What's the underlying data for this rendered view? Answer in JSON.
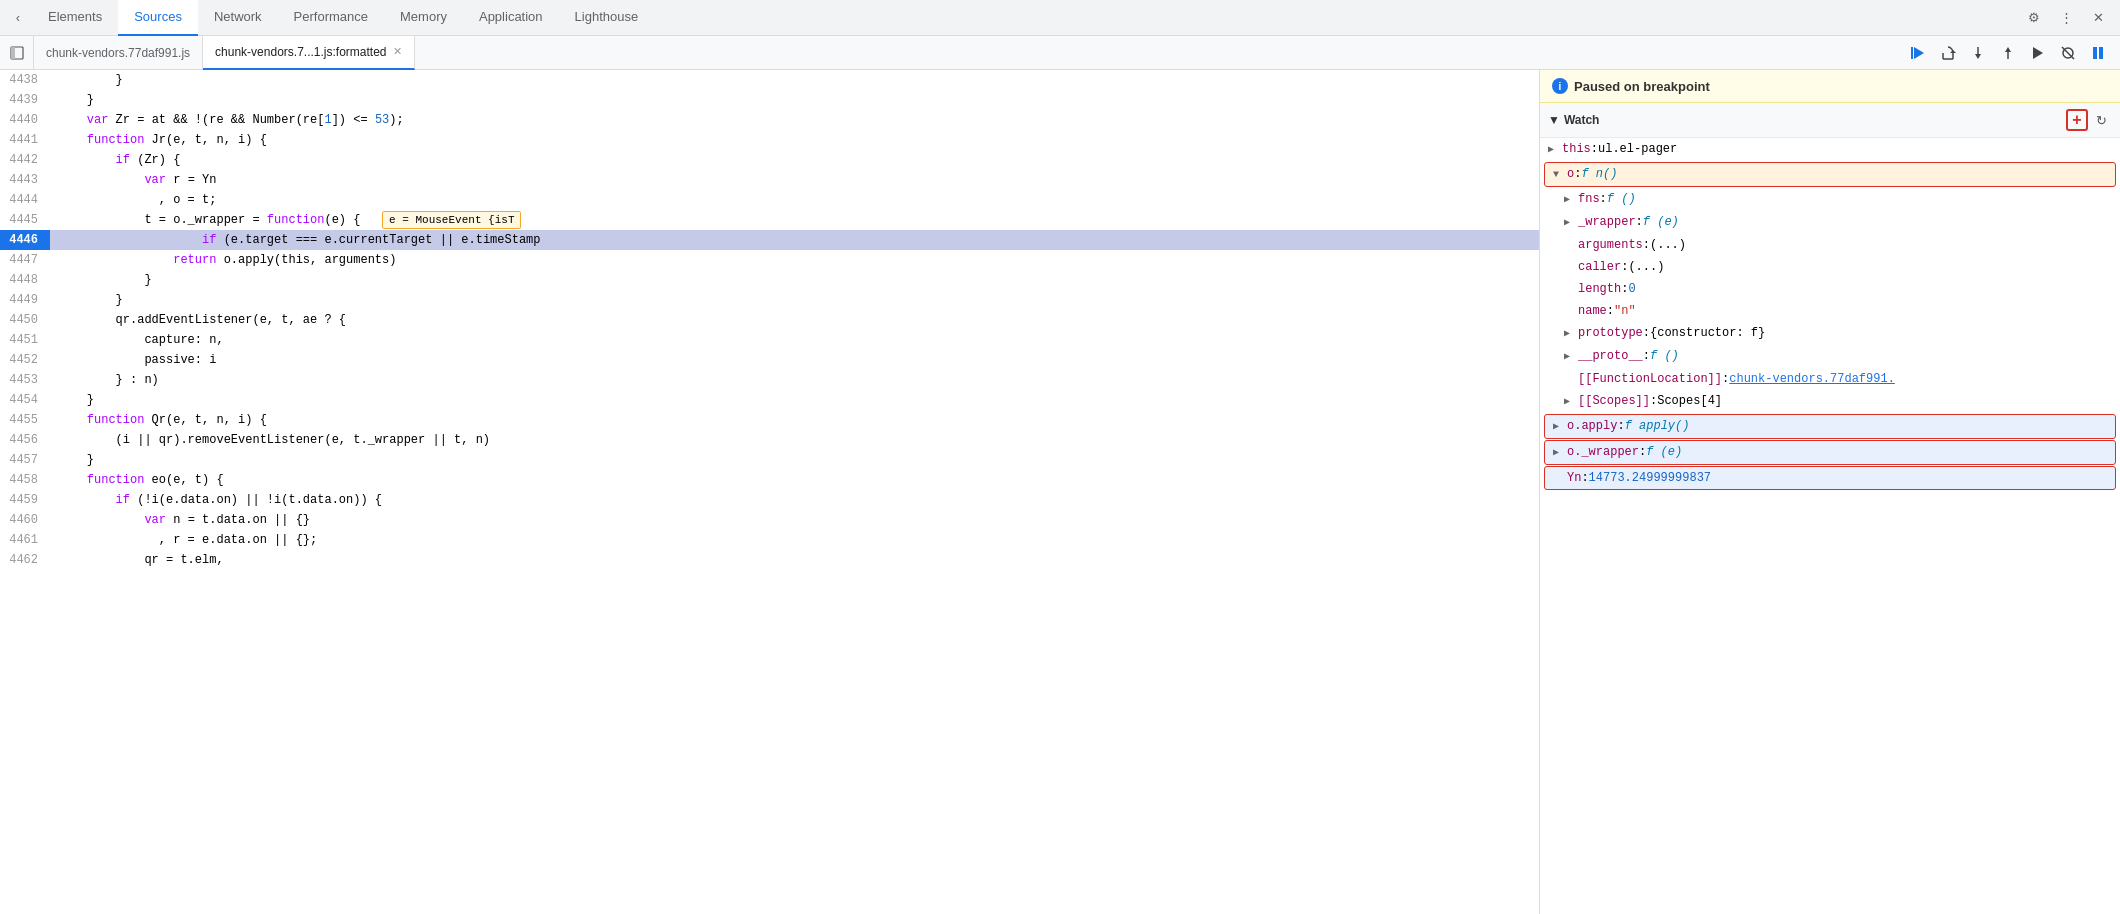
{
  "tabs": {
    "items": [
      {
        "label": "Elements",
        "active": false
      },
      {
        "label": "Sources",
        "active": true
      },
      {
        "label": "Network",
        "active": false
      },
      {
        "label": "Performance",
        "active": false
      },
      {
        "label": "Memory",
        "active": false
      },
      {
        "label": "Application",
        "active": false
      },
      {
        "label": "Lighthouse",
        "active": false
      }
    ]
  },
  "file_tabs": {
    "tab1": {
      "label": "chunk-vendors.77daf991.js",
      "active": false
    },
    "tab2": {
      "label": "chunk-vendors.7...1.js:formatted",
      "active": true
    }
  },
  "breakpoint_notice": {
    "text": "Paused on breakpoint"
  },
  "watch": {
    "title": "Watch",
    "add_label": "+",
    "items": [
      {
        "indent": 0,
        "arrow": "▶",
        "name": "this",
        "colon": ":",
        "value": "ul.el-pager",
        "type": "plain"
      },
      {
        "indent": 0,
        "arrow": "▼",
        "name": "o",
        "colon": ":",
        "value": "f n()",
        "type": "fn",
        "highlighted": true
      },
      {
        "indent": 1,
        "arrow": "▶",
        "name": "fns",
        "colon": ":",
        "value": "f ()",
        "type": "fn"
      },
      {
        "indent": 1,
        "arrow": "▶",
        "name": "_wrapper",
        "colon": ":",
        "value": "f (e)",
        "type": "fn"
      },
      {
        "indent": 1,
        "arrow": "",
        "name": "arguments",
        "colon": ":",
        "value": "(...)",
        "type": "plain"
      },
      {
        "indent": 1,
        "arrow": "",
        "name": "caller",
        "colon": ":",
        "value": "(...)",
        "type": "plain"
      },
      {
        "indent": 1,
        "arrow": "",
        "name": "length",
        "colon": ":",
        "value": "0",
        "type": "num"
      },
      {
        "indent": 1,
        "arrow": "",
        "name": "name",
        "colon": ":",
        "value": "\"n\"",
        "type": "str"
      },
      {
        "indent": 1,
        "arrow": "▶",
        "name": "prototype",
        "colon": ":",
        "value": "{constructor: f}",
        "type": "plain"
      },
      {
        "indent": 1,
        "arrow": "▶",
        "name": "__proto__",
        "colon": ":",
        "value": "f ()",
        "type": "fn"
      },
      {
        "indent": 1,
        "arrow": "",
        "name": "[[FunctionLocation]]",
        "colon": ":",
        "value": "chunk-vendors.77daf991.",
        "type": "link"
      },
      {
        "indent": 1,
        "arrow": "▶",
        "name": "[[Scopes]]",
        "colon": ":",
        "value": "Scopes[4]",
        "type": "plain"
      },
      {
        "indent": 0,
        "arrow": "▶",
        "name": "o.apply",
        "colon": ":",
        "value": "f apply()",
        "type": "fn",
        "highlighted_blue": true
      },
      {
        "indent": 0,
        "arrow": "▶",
        "name": "o._wrapper",
        "colon": ":",
        "value": "f (e)",
        "type": "fn",
        "highlighted_blue": true
      },
      {
        "indent": 0,
        "arrow": "",
        "name": "Yn",
        "colon": ":",
        "value": "14773.24999999837",
        "type": "num",
        "highlighted_blue": true
      }
    ]
  },
  "code_lines": [
    {
      "num": 4438,
      "content": "        }",
      "active": false
    },
    {
      "num": 4439,
      "content": "    }",
      "active": false
    },
    {
      "num": 4440,
      "content": "    var Zr = at && !(re && Number(re[1]) <= 53);",
      "active": false
    },
    {
      "num": 4441,
      "content": "    function Jr(e, t, n, i) {",
      "active": false
    },
    {
      "num": 4442,
      "content": "        if (Zr) {",
      "active": false
    },
    {
      "num": 4443,
      "content": "            var r = Yn",
      "active": false
    },
    {
      "num": 4444,
      "content": "              , o = t;",
      "active": false
    },
    {
      "num": 4445,
      "content": "            t = o._wrapper = function(e) {    e = MouseEvent {isT",
      "active": false,
      "tooltip": "e = MouseEvent {isT"
    },
    {
      "num": 4446,
      "content": "                    if (e.target === e.currentTarget || e.timeStamp",
      "active": true
    },
    {
      "num": 4447,
      "content": "                return o.apply(this, arguments)",
      "active": false
    },
    {
      "num": 4448,
      "content": "            }",
      "active": false
    },
    {
      "num": 4449,
      "content": "        }",
      "active": false
    },
    {
      "num": 4450,
      "content": "        qr.addEventListener(e, t, ae ? {",
      "active": false
    },
    {
      "num": 4451,
      "content": "            capture: n,",
      "active": false
    },
    {
      "num": 4452,
      "content": "            passive: i",
      "active": false
    },
    {
      "num": 4453,
      "content": "        } : n)",
      "active": false
    },
    {
      "num": 4454,
      "content": "    }",
      "active": false
    },
    {
      "num": 4455,
      "content": "    function Qr(e, t, n, i) {",
      "active": false
    },
    {
      "num": 4456,
      "content": "        (i || qr).removeEventListener(e, t._wrapper || t, n)",
      "active": false
    },
    {
      "num": 4457,
      "content": "    }",
      "active": false
    },
    {
      "num": 4458,
      "content": "    function eo(e, t) {",
      "active": false
    },
    {
      "num": 4459,
      "content": "        if (!i(e.data.on) || !i(t.data.on)) {",
      "active": false
    },
    {
      "num": 4460,
      "content": "            var n = t.data.on || {}",
      "active": false
    },
    {
      "num": 4461,
      "content": "              , r = e.data.on || {};",
      "active": false
    },
    {
      "num": 4462,
      "content": "            qr = t.elm,",
      "active": false
    }
  ]
}
